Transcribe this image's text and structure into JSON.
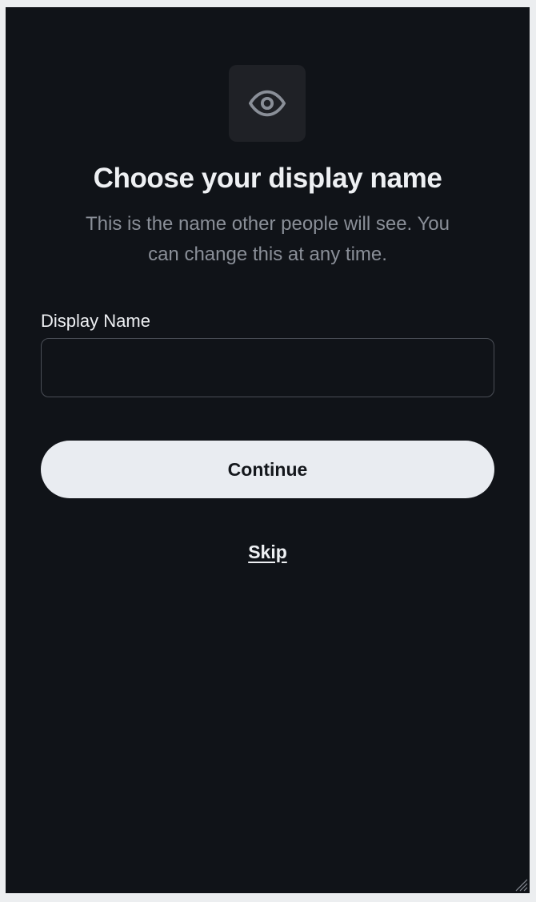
{
  "icon": {
    "name": "eye-icon",
    "color": "#8a8f98"
  },
  "header": {
    "title": "Choose your display name",
    "subtitle": "This is the name other people will see. You can change this at any time."
  },
  "form": {
    "display_name_label": "Display Name",
    "display_name_value": "",
    "display_name_placeholder": ""
  },
  "actions": {
    "continue_label": "Continue",
    "skip_label": "Skip"
  },
  "colors": {
    "background": "#101318",
    "icon_tile": "#1f2126",
    "primary_button": "#e9ecf1",
    "text_primary": "#eef0f3",
    "text_secondary": "#8a8f98"
  }
}
